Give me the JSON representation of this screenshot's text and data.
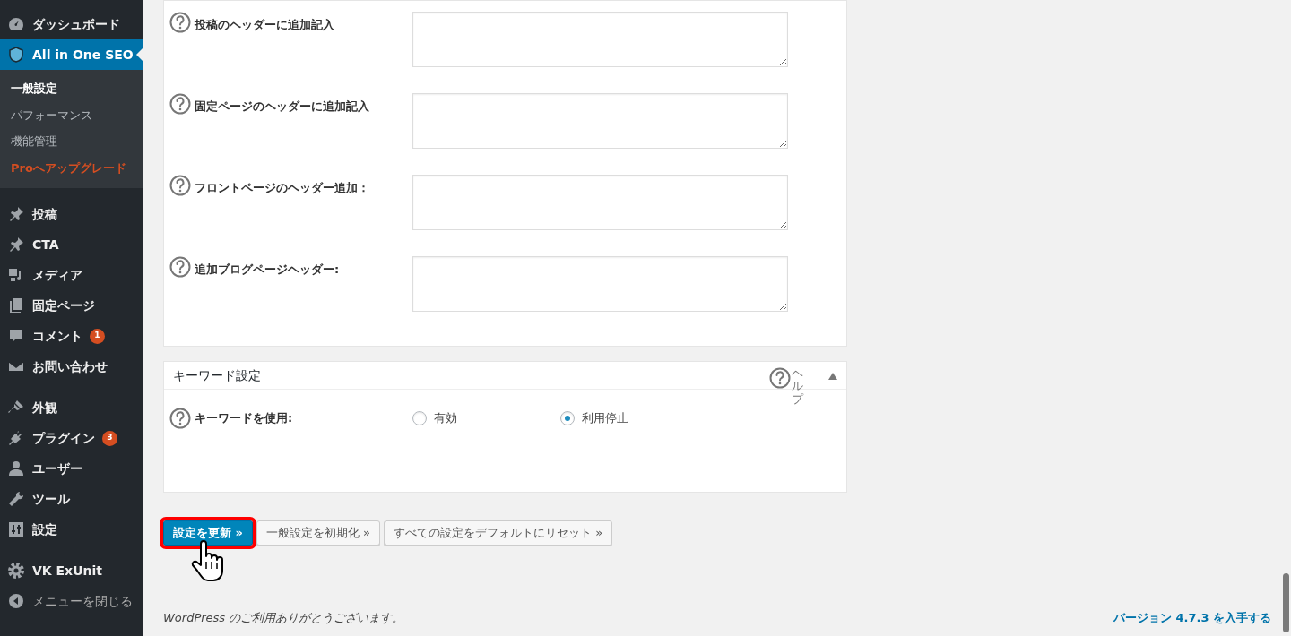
{
  "sidebar": {
    "groups": [
      {
        "items": [
          {
            "label": "ダッシュボード",
            "selected": false
          },
          {
            "label": "All in One SEO",
            "selected": true,
            "submenu": [
              {
                "label": "一般設定",
                "selected": true,
                "kind": "normal"
              },
              {
                "label": "パフォーマンス",
                "selected": false,
                "kind": "normal"
              },
              {
                "label": "機能管理",
                "selected": false,
                "kind": "normal"
              },
              {
                "label": "Proへアップグレード",
                "selected": false,
                "kind": "upgrade"
              }
            ]
          }
        ]
      },
      {
        "items": [
          {
            "label": "投稿",
            "selected": false
          },
          {
            "label": "CTA",
            "selected": false
          },
          {
            "label": "メディア",
            "selected": false
          },
          {
            "label": "固定ページ",
            "selected": false
          },
          {
            "label": "コメント",
            "selected": false,
            "badge": "1"
          },
          {
            "label": "お問い合わせ",
            "selected": false
          }
        ]
      },
      {
        "items": [
          {
            "label": "外観",
            "selected": false
          },
          {
            "label": "プラグイン",
            "selected": false,
            "badge": "3"
          },
          {
            "label": "ユーザー",
            "selected": false
          },
          {
            "label": "ツール",
            "selected": false
          },
          {
            "label": "設定",
            "selected": false
          }
        ]
      },
      {
        "items": [
          {
            "label": "VK ExUnit",
            "selected": false
          },
          {
            "label": "メニューを閉じる",
            "selected": false,
            "kind": "collapse"
          }
        ]
      }
    ]
  },
  "header_fields": [
    {
      "label": "投稿のヘッダーに追加記入"
    },
    {
      "label": "固定ページのヘッダーに追加記入"
    },
    {
      "label": "フロントページのヘッダー追加："
    },
    {
      "label": "追加ブログページヘッダー:"
    }
  ],
  "keyword_panel": {
    "title": "キーワード設定",
    "help": "ヘルプ",
    "expanded": true,
    "option": {
      "label": "キーワードを使用:",
      "choices": [
        {
          "label": "有効",
          "selected": false
        },
        {
          "label": "利用停止",
          "selected": true
        }
      ]
    }
  },
  "buttons": [
    {
      "label": "設定を更新 »",
      "kind": "primary",
      "highlighted": true
    },
    {
      "label": "一般設定を初期化 »",
      "kind": "secondary",
      "highlighted": false
    },
    {
      "label": "すべての設定をデフォルトにリセット »",
      "kind": "secondary",
      "highlighted": false
    }
  ],
  "footer": {
    "link": "WordPress",
    "text": "のご利用ありがとうございます。",
    "version_link": "バージョン 4.7.3 を入手する"
  }
}
